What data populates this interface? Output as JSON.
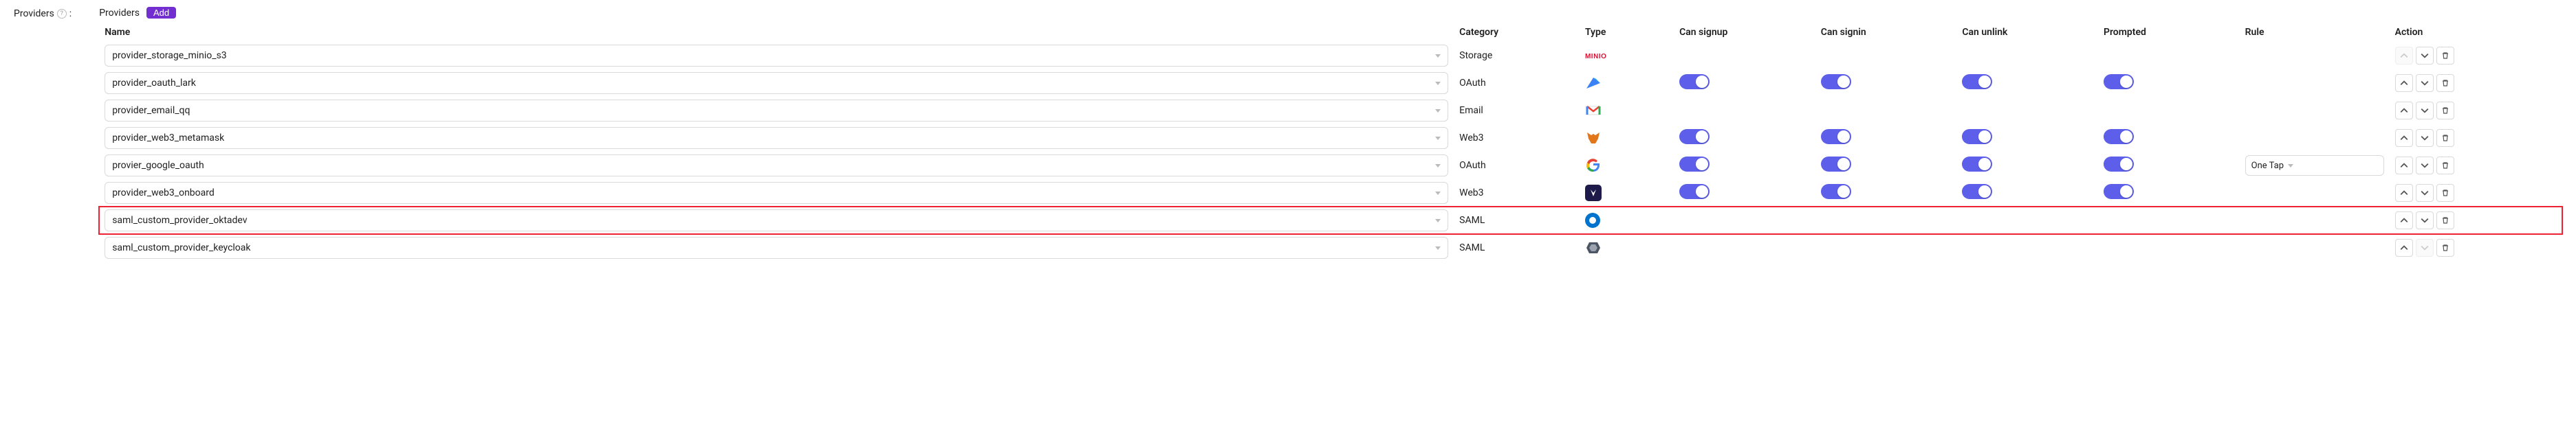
{
  "field_label": "Providers",
  "title": "Providers",
  "add_label": "Add",
  "columns": {
    "name": "Name",
    "category": "Category",
    "type": "Type",
    "can_signup": "Can signup",
    "can_signin": "Can signin",
    "can_unlink": "Can unlink",
    "prompted": "Prompted",
    "rule": "Rule",
    "action": "Action"
  },
  "rows": [
    {
      "name": "provider_storage_minio_s3",
      "category": "Storage",
      "type_icon": "minio",
      "can_signup": null,
      "can_signin": null,
      "can_unlink": null,
      "prompted": null,
      "rule": null,
      "up_disabled": true,
      "down_disabled": false,
      "del_disabled": false,
      "highlight": false
    },
    {
      "name": "provider_oauth_lark",
      "category": "OAuth",
      "type_icon": "lark",
      "can_signup": true,
      "can_signin": true,
      "can_unlink": true,
      "prompted": true,
      "rule": null,
      "up_disabled": false,
      "down_disabled": false,
      "del_disabled": false,
      "highlight": false
    },
    {
      "name": "provider_email_qq",
      "category": "Email",
      "type_icon": "gmail",
      "can_signup": null,
      "can_signin": null,
      "can_unlink": null,
      "prompted": null,
      "rule": null,
      "up_disabled": false,
      "down_disabled": false,
      "del_disabled": false,
      "highlight": false
    },
    {
      "name": "provider_web3_metamask",
      "category": "Web3",
      "type_icon": "metamask",
      "can_signup": true,
      "can_signin": true,
      "can_unlink": true,
      "prompted": true,
      "rule": null,
      "up_disabled": false,
      "down_disabled": false,
      "del_disabled": false,
      "highlight": false
    },
    {
      "name": "provier_google_oauth",
      "category": "OAuth",
      "type_icon": "google",
      "can_signup": true,
      "can_signin": true,
      "can_unlink": true,
      "prompted": true,
      "rule": "One Tap",
      "up_disabled": false,
      "down_disabled": false,
      "del_disabled": false,
      "highlight": false
    },
    {
      "name": "provider_web3_onboard",
      "category": "Web3",
      "type_icon": "onboard",
      "can_signup": true,
      "can_signin": true,
      "can_unlink": true,
      "prompted": true,
      "rule": null,
      "up_disabled": false,
      "down_disabled": false,
      "del_disabled": false,
      "highlight": false
    },
    {
      "name": "saml_custom_provider_oktadev",
      "category": "SAML",
      "type_icon": "okta",
      "can_signup": null,
      "can_signin": null,
      "can_unlink": null,
      "prompted": null,
      "rule": null,
      "up_disabled": false,
      "down_disabled": false,
      "del_disabled": false,
      "highlight": true
    },
    {
      "name": "saml_custom_provider_keycloak",
      "category": "SAML",
      "type_icon": "keycloak",
      "can_signup": null,
      "can_signin": null,
      "can_unlink": null,
      "prompted": null,
      "rule": null,
      "up_disabled": false,
      "down_disabled": true,
      "del_disabled": false,
      "highlight": false
    }
  ]
}
